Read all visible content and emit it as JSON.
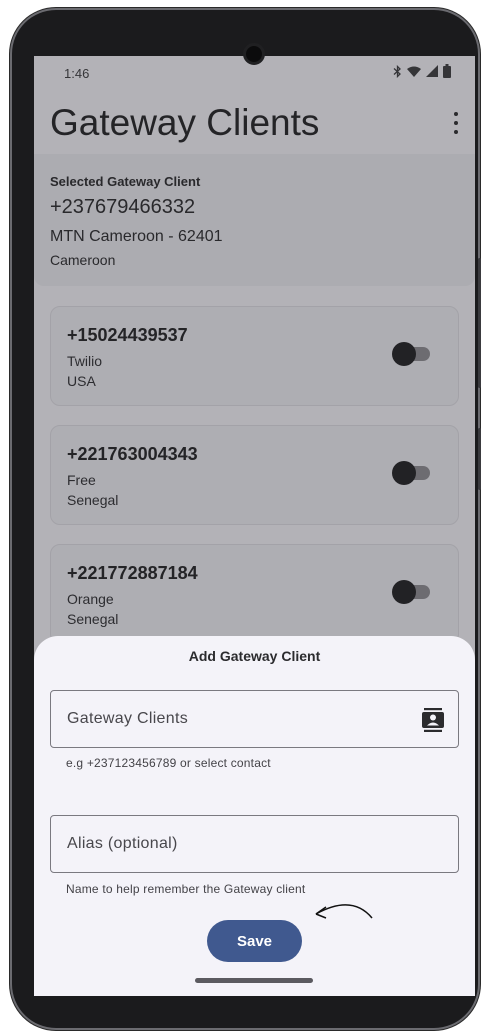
{
  "status_bar": {
    "time": "1:46"
  },
  "app_bar": {
    "title": "Gateway Clients"
  },
  "selected_client": {
    "label": "Selected Gateway Client",
    "number": "+237679466332",
    "provider": "MTN Cameroon - 62401",
    "country": "Cameroon"
  },
  "clients": [
    {
      "number": "+15024439537",
      "provider": "Twilio",
      "country": "USA",
      "enabled": false
    },
    {
      "number": "+221763004343",
      "provider": "Free",
      "country": "Senegal",
      "enabled": false
    },
    {
      "number": "+221772887184",
      "provider": "Orange",
      "country": "Senegal",
      "enabled": false
    }
  ],
  "sheet": {
    "title": "Add Gateway Client",
    "gateway_field": {
      "placeholder": "Gateway Clients",
      "value": "",
      "helper": "e.g +237123456789 or select contact"
    },
    "alias_field": {
      "placeholder": "Alias (optional)",
      "value": "",
      "helper": "Name to help remember the Gateway client"
    },
    "save_label": "Save"
  },
  "colors": {
    "accent": "#40598f",
    "surface": "#f4f3f9",
    "text": "#2b2b2e"
  },
  "icons": {
    "status": [
      "bluetooth-icon",
      "wifi-icon",
      "signal-icon",
      "battery-icon"
    ],
    "overflow": "more-vert-icon",
    "contact": "contact-book-icon"
  }
}
